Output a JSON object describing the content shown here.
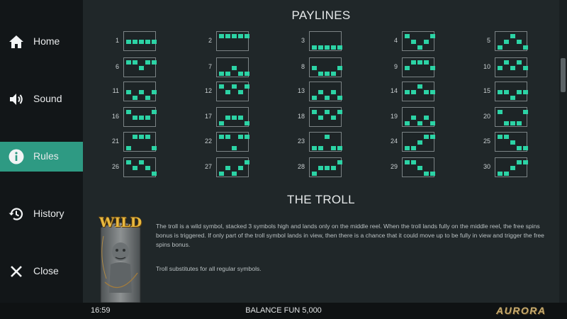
{
  "sidebar": {
    "items": [
      {
        "label": "Home",
        "icon": "home-icon",
        "active": false
      },
      {
        "label": "Sound",
        "icon": "speaker-icon",
        "active": false
      },
      {
        "label": "Rules",
        "icon": "info-icon",
        "active": true
      },
      {
        "label": "History",
        "icon": "history-icon",
        "active": false
      },
      {
        "label": "Close",
        "icon": "close-icon",
        "active": false
      }
    ]
  },
  "paylines": {
    "title": "PAYLINES",
    "lines": [
      {
        "number": "1",
        "rows": [
          1,
          1,
          1,
          1,
          1
        ]
      },
      {
        "number": "2",
        "rows": [
          0,
          0,
          0,
          0,
          0
        ]
      },
      {
        "number": "3",
        "rows": [
          2,
          2,
          2,
          2,
          2
        ]
      },
      {
        "number": "4",
        "rows": [
          0,
          1,
          2,
          1,
          0
        ]
      },
      {
        "number": "5",
        "rows": [
          2,
          1,
          0,
          1,
          2
        ]
      },
      {
        "number": "6",
        "rows": [
          0,
          0,
          1,
          0,
          0
        ]
      },
      {
        "number": "7",
        "rows": [
          2,
          2,
          1,
          2,
          2
        ]
      },
      {
        "number": "8",
        "rows": [
          1,
          2,
          2,
          2,
          1
        ]
      },
      {
        "number": "9",
        "rows": [
          1,
          0,
          0,
          0,
          1
        ]
      },
      {
        "number": "10",
        "rows": [
          1,
          0,
          1,
          0,
          1
        ]
      },
      {
        "number": "11",
        "rows": [
          1,
          2,
          1,
          2,
          1
        ]
      },
      {
        "number": "12",
        "rows": [
          0,
          1,
          0,
          1,
          0
        ]
      },
      {
        "number": "13",
        "rows": [
          2,
          1,
          2,
          1,
          2
        ]
      },
      {
        "number": "14",
        "rows": [
          1,
          1,
          0,
          1,
          1
        ]
      },
      {
        "number": "15",
        "rows": [
          1,
          1,
          2,
          1,
          1
        ]
      },
      {
        "number": "16",
        "rows": [
          0,
          1,
          1,
          1,
          0
        ]
      },
      {
        "number": "17",
        "rows": [
          2,
          1,
          1,
          1,
          2
        ]
      },
      {
        "number": "18",
        "rows": [
          0,
          1,
          0,
          1,
          0
        ]
      },
      {
        "number": "19",
        "rows": [
          2,
          1,
          2,
          1,
          2
        ]
      },
      {
        "number": "20",
        "rows": [
          0,
          2,
          2,
          2,
          0
        ]
      },
      {
        "number": "21",
        "rows": [
          2,
          0,
          0,
          0,
          2
        ]
      },
      {
        "number": "22",
        "rows": [
          0,
          0,
          2,
          0,
          0
        ]
      },
      {
        "number": "23",
        "rows": [
          2,
          2,
          0,
          2,
          2
        ]
      },
      {
        "number": "24",
        "rows": [
          2,
          2,
          1,
          0,
          0
        ]
      },
      {
        "number": "25",
        "rows": [
          0,
          0,
          1,
          2,
          2
        ]
      },
      {
        "number": "26",
        "rows": [
          0,
          1,
          0,
          1,
          2
        ]
      },
      {
        "number": "27",
        "rows": [
          2,
          1,
          2,
          1,
          0
        ]
      },
      {
        "number": "28",
        "rows": [
          2,
          1,
          1,
          1,
          0
        ]
      },
      {
        "number": "29",
        "rows": [
          0,
          0,
          1,
          2,
          2
        ]
      },
      {
        "number": "30",
        "rows": [
          2,
          2,
          1,
          0,
          0
        ]
      }
    ]
  },
  "troll": {
    "title": "THE TROLL",
    "wild_label": "WILD",
    "paragraph1": "The troll is a wild symbol, stacked 3 symbols high and lands only on the middle reel. When the troll lands fully on the middle reel, the free spins bonus is triggered. If only part of the troll symbol lands in view, then there is a chance that it could move up to be fully in view and trigger the free spins bonus.",
    "paragraph2": "Troll substitutes for all regular symbols."
  },
  "footer": {
    "time": "16:59",
    "balance_label": "BALANCE",
    "balance_value": "FUN 5,000",
    "logo": "AURORA"
  },
  "colors": {
    "accent": "#2e9a83",
    "payline_cell": "#2cd3a5",
    "logo_gold": "#c7ab6e"
  }
}
